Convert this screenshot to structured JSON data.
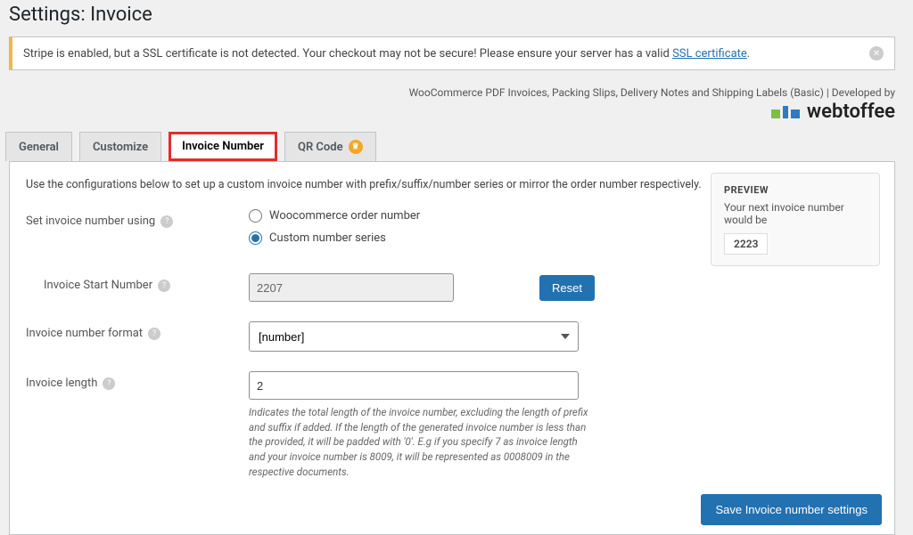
{
  "page_title": "Settings: Invoice",
  "notice": {
    "text_before": "Stripe is enabled, but a SSL certificate is not detected. Your checkout may not be secure! Please ensure your server has a valid ",
    "link_text": "SSL certificate",
    "text_after": "."
  },
  "credit_line": "WooCommerce PDF Invoices, Packing Slips, Delivery Notes and Shipping Labels (Basic) | Developed by",
  "logo_text": "webtoffee",
  "tabs": {
    "general": "General",
    "customize": "Customize",
    "invoice_number": "Invoice Number",
    "qr_code": "QR Code"
  },
  "intro": "Use the configurations below to set up a custom invoice number with prefix/suffix/number series or mirror the order number respectively.",
  "fields": {
    "set_using": {
      "label": "Set invoice number using",
      "option_wc": "Woocommerce order number",
      "option_custom": "Custom number series"
    },
    "start_number": {
      "label": "Invoice Start Number",
      "value": "2207",
      "reset": "Reset"
    },
    "format": {
      "label": "Invoice number format",
      "value": "[number]"
    },
    "length": {
      "label": "Invoice length",
      "value": "2",
      "hint": "Indicates the total length of the invoice number, excluding the length of prefix and suffix if added. If the length of the generated invoice number is less than the provided, it will be padded with '0'. E.g if you specify 7 as invoice length and your invoice number is 8009, it will be represented as 0008009 in the respective documents."
    }
  },
  "preview": {
    "heading": "PREVIEW",
    "text": "Your next invoice number would be",
    "number": "2223"
  },
  "save_button": "Save Invoice number settings"
}
